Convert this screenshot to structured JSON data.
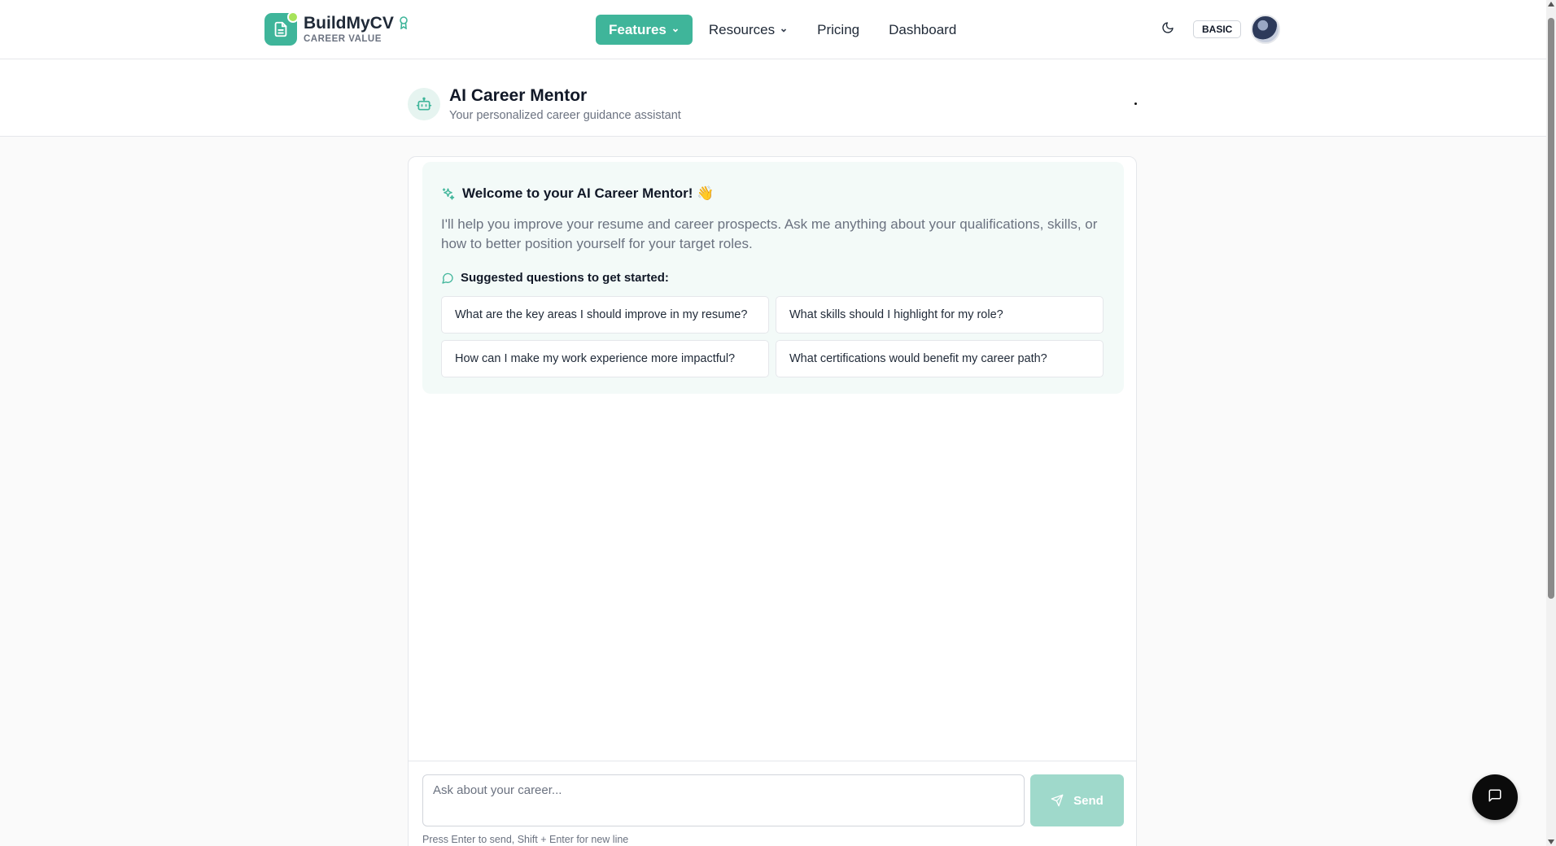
{
  "brand": {
    "name": "BuildMyCV",
    "tagline": "CAREER VALUE",
    "logo_icon": "document-icon",
    "badge_icon": "award-icon",
    "accent": "#3fb59a"
  },
  "nav": {
    "items": [
      {
        "label": "Features",
        "active": true,
        "has_dropdown": true
      },
      {
        "label": "Resources",
        "active": false,
        "has_dropdown": true
      },
      {
        "label": "Pricing",
        "active": false,
        "has_dropdown": false
      },
      {
        "label": "Dashboard",
        "active": false,
        "has_dropdown": false
      }
    ]
  },
  "header_tools": {
    "theme_icon": "moon-icon",
    "plan_badge": "BASIC"
  },
  "page": {
    "title": "AI Career Mentor",
    "subtitle": "Your personalized career guidance assistant",
    "icon": "bot-icon"
  },
  "welcome": {
    "title": "Welcome to your AI Career Mentor! 👋",
    "text": "I'll help you improve your resume and career prospects. Ask me anything about your qualifications, skills, or how to better position yourself for your target roles.",
    "suggest_title": "Suggested questions to get started:",
    "suggestions": [
      "What are the key areas I should improve in my resume?",
      "What skills should I highlight for my role?",
      "How can I make my work experience more impactful?",
      "What certifications would benefit my career path?"
    ]
  },
  "composer": {
    "placeholder": "Ask about your career...",
    "send_label": "Send",
    "hint": "Press Enter to send, Shift + Enter for new line"
  },
  "fab": {
    "icon": "message-square-icon"
  }
}
